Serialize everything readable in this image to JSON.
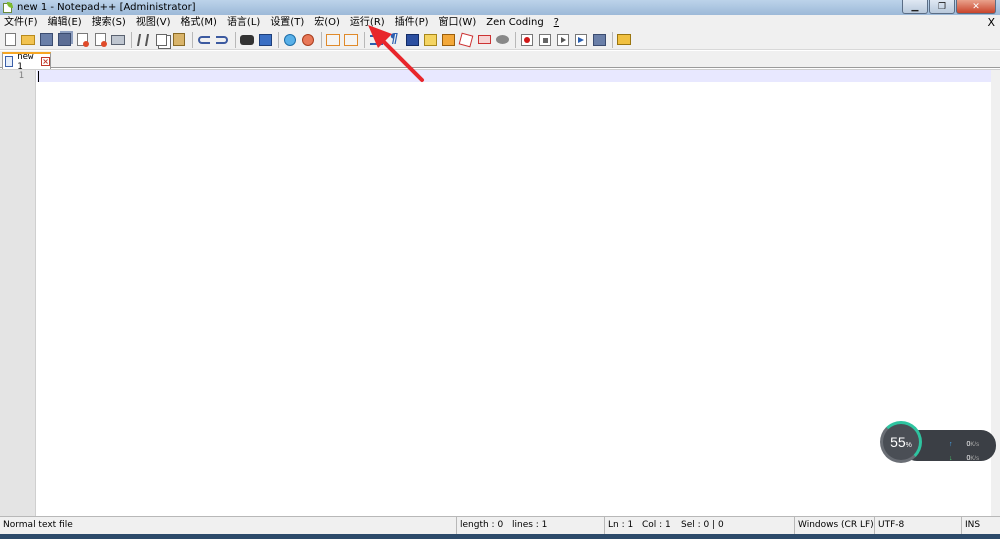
{
  "window": {
    "title": "new 1 - Notepad++ [Administrator]",
    "minimize_glyph": "▁",
    "restore_glyph": "❐",
    "close_glyph": "✕"
  },
  "menu": {
    "items": [
      {
        "label": "文件(F)"
      },
      {
        "label": "编辑(E)"
      },
      {
        "label": "搜索(S)"
      },
      {
        "label": "视图(V)"
      },
      {
        "label": "格式(M)"
      },
      {
        "label": "语言(L)"
      },
      {
        "label": "设置(T)"
      },
      {
        "label": "宏(O)"
      },
      {
        "label": "运行(R)"
      },
      {
        "label": "插件(P)"
      },
      {
        "label": "窗口(W)"
      },
      {
        "label": "Zen Coding"
      },
      {
        "label": "?"
      }
    ],
    "close_label": "X"
  },
  "tabs": [
    {
      "label": "new 1",
      "close_glyph": "×"
    }
  ],
  "editor": {
    "line_numbers": [
      "1"
    ]
  },
  "status": {
    "file_type": "Normal text file",
    "length": "length : 0",
    "lines": "lines : 1",
    "ln": "Ln : 1",
    "col": "Col : 1",
    "sel": "Sel : 0 | 0",
    "eol": "Windows (CR LF)",
    "encoding": "UTF-8",
    "mode": "INS"
  },
  "network_widget": {
    "percent": "55",
    "percent_unit": "%",
    "upload": "0",
    "download": "0",
    "unit": "K/s",
    "up_glyph": "↑",
    "down_glyph": "↓"
  },
  "colors": {
    "annotation_arrow": "#e8262b",
    "tab_accent": "#f6a623",
    "current_line": "#e8e8ff"
  }
}
